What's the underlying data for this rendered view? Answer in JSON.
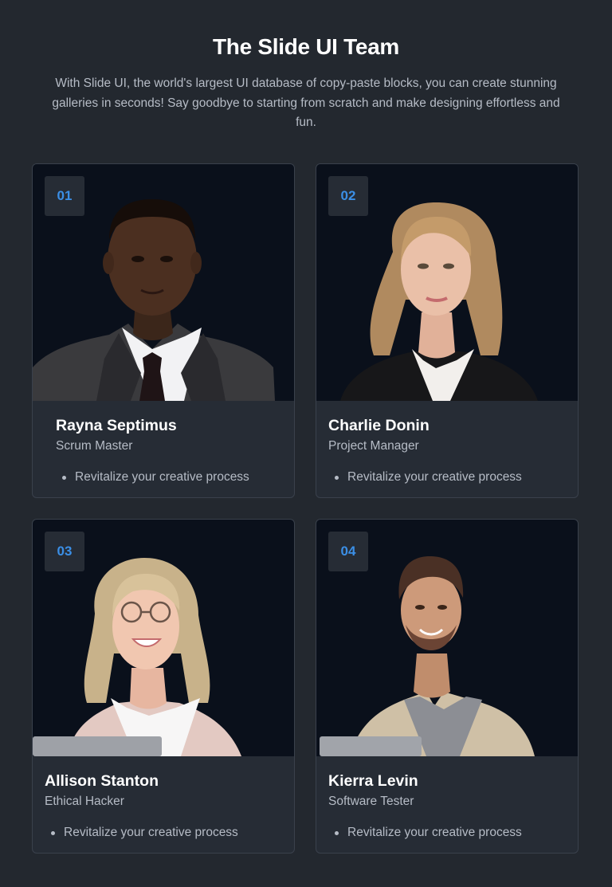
{
  "header": {
    "title": "The Slide UI Team",
    "subtitle": "With Slide UI, the world's largest UI database of copy-paste blocks, you can create stunning galleries in seconds! Say goodbye to starting from scratch and make designing effortless and fun."
  },
  "colors": {
    "background": "#23282f",
    "card": "#262c35",
    "photo_background": "#0a101b",
    "badge_text": "#3b8fe6"
  },
  "team": [
    {
      "number": "01",
      "name": "Rayna Septimus",
      "role": "Scrum Master",
      "points": [
        "Revitalize your creative process"
      ],
      "photo_icon": "man-in-suit-portrait"
    },
    {
      "number": "02",
      "name": "Charlie Donin",
      "role": "Project Manager",
      "points": [
        "Revitalize your creative process"
      ],
      "photo_icon": "woman-in-blazer-portrait"
    },
    {
      "number": "03",
      "name": "Allison Stanton",
      "role": "Ethical Hacker",
      "points": [
        "Revitalize your creative process"
      ],
      "photo_icon": "woman-with-glasses-and-laptop-portrait"
    },
    {
      "number": "04",
      "name": "Kierra Levin",
      "role": "Software Tester",
      "points": [
        "Revitalize your creative process"
      ],
      "photo_icon": "man-in-jacket-with-laptop-portrait"
    }
  ]
}
